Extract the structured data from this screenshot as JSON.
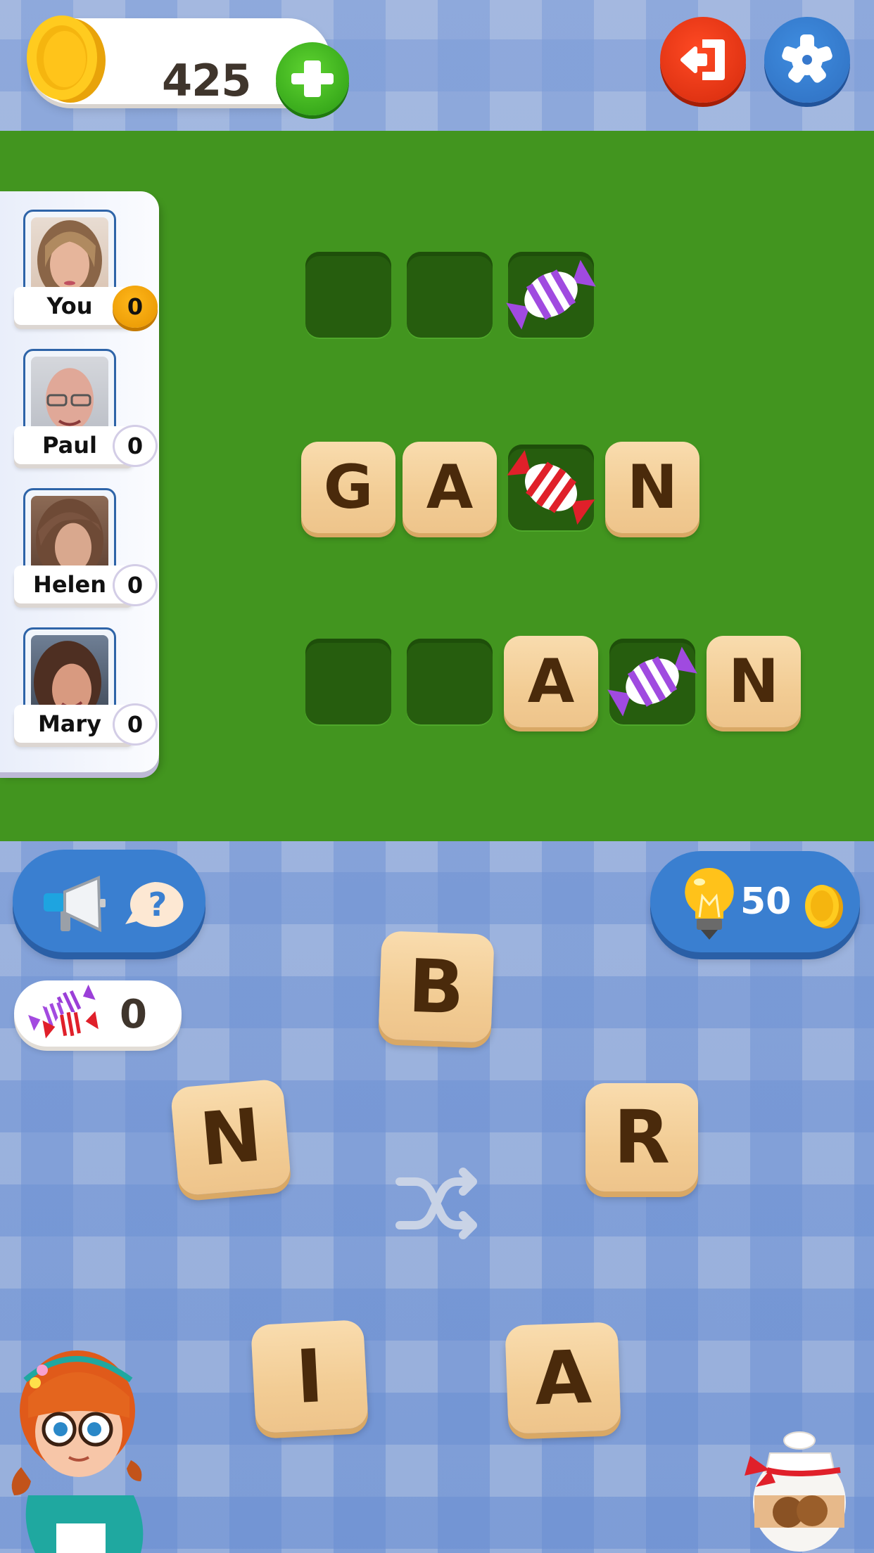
{
  "header": {
    "coins": "425",
    "icons": {
      "coin": "gold-coin-icon",
      "add": "plus-icon",
      "exit": "exit-door-icon",
      "settings": "gear-icon"
    },
    "colors": {
      "add_button": "#3bb31b",
      "exit_button": "#e8361a",
      "settings_button": "#3778cc"
    }
  },
  "board": {
    "background": "#42951f",
    "players": [
      {
        "name": "You",
        "score": "0",
        "is_current": true
      },
      {
        "name": "Paul",
        "score": "0",
        "is_current": false
      },
      {
        "name": "Helen",
        "score": "0",
        "is_current": false
      },
      {
        "name": "Mary",
        "score": "0",
        "is_current": false
      }
    ],
    "words": [
      {
        "cells": [
          {
            "letter": "",
            "candy": ""
          },
          {
            "letter": "",
            "candy": ""
          },
          {
            "letter": "",
            "candy": "purple"
          }
        ]
      },
      {
        "cells": [
          {
            "letter": "G",
            "candy": ""
          },
          {
            "letter": "A",
            "candy": ""
          },
          {
            "letter": "",
            "candy": "red"
          },
          {
            "letter": "N",
            "candy": ""
          }
        ]
      },
      {
        "cells": [
          {
            "letter": "",
            "candy": ""
          },
          {
            "letter": "",
            "candy": ""
          },
          {
            "letter": "A",
            "candy": ""
          },
          {
            "letter": "",
            "candy": "purple"
          },
          {
            "letter": "N",
            "candy": ""
          }
        ]
      }
    ]
  },
  "controls": {
    "ask_button_icons": [
      "megaphone-icon",
      "question-bubble-icon"
    ],
    "hint": {
      "cost": "50",
      "icon": "lightbulb-icon"
    },
    "candy_counter": {
      "count": "0",
      "icon": "candies-icon"
    },
    "letter_wheel": [
      "B",
      "R",
      "A",
      "I",
      "N"
    ],
    "shuffle_icon": "shuffle-icon",
    "cookie_jar_icon": "cookie-jar-icon",
    "mascot": "girl-mascot"
  }
}
